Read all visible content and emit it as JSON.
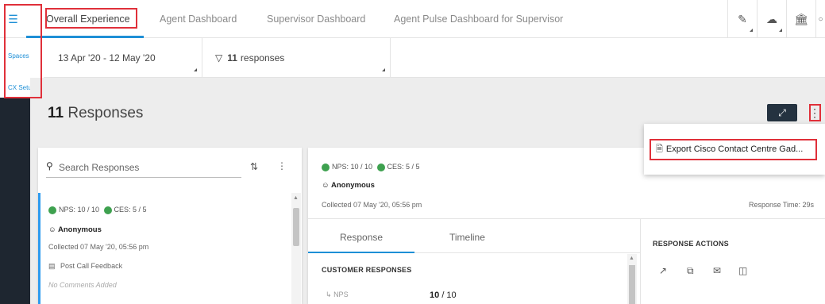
{
  "topbar": {
    "menu_icon": "hamburger-icon",
    "tabs": [
      {
        "label": "Overall Experience",
        "active": true
      },
      {
        "label": "Agent Dashboard",
        "active": false
      },
      {
        "label": "Supervisor Dashboard",
        "active": false
      },
      {
        "label": "Agent Pulse Dashboard for Supervisor",
        "active": false
      }
    ],
    "tools": [
      "pencil-icon",
      "cloud-icon",
      "bank-icon",
      "more-icon"
    ]
  },
  "leftnav": {
    "items": [
      {
        "label": "Spaces"
      },
      {
        "label": "CX Setup"
      }
    ]
  },
  "filters": {
    "date_range": "13 Apr '20 - 12 May '20",
    "responses_count": "11",
    "responses_label": "responses"
  },
  "main": {
    "title_count": "11",
    "title_label": "Responses",
    "search_placeholder": "Search Responses"
  },
  "list": {
    "item": {
      "nps": "NPS: 10 / 10",
      "ces": "CES: 5 / 5",
      "respondent": "Anonymous",
      "collected": "Collected 07 May '20, 05:56 pm",
      "survey": "Post Call Feedback",
      "comments": "No Comments Added"
    }
  },
  "detail": {
    "nps": "NPS: 10 / 10",
    "ces": "CES: 5 / 5",
    "respondent": "Anonymous",
    "collected": "Collected 07 May '20, 05:56 pm",
    "response_time": "Response Time: 29s",
    "tabs": [
      {
        "label": "Response",
        "active": true
      },
      {
        "label": "Timeline",
        "active": false
      }
    ],
    "customer_responses_label": "CUSTOMER RESPONSES",
    "response_actions_label": "RESPONSE ACTIONS",
    "nps_row_label": "NPS",
    "nps_row_value": "10",
    "nps_row_max": "/ 10"
  },
  "dropdown": {
    "export_label": "Export Cisco Contact Centre Gad..."
  },
  "colors": {
    "accent": "#1e8fd6",
    "highlight": "#e0303a",
    "dark_button": "#243240",
    "positive_dot": "#3ea14f"
  }
}
